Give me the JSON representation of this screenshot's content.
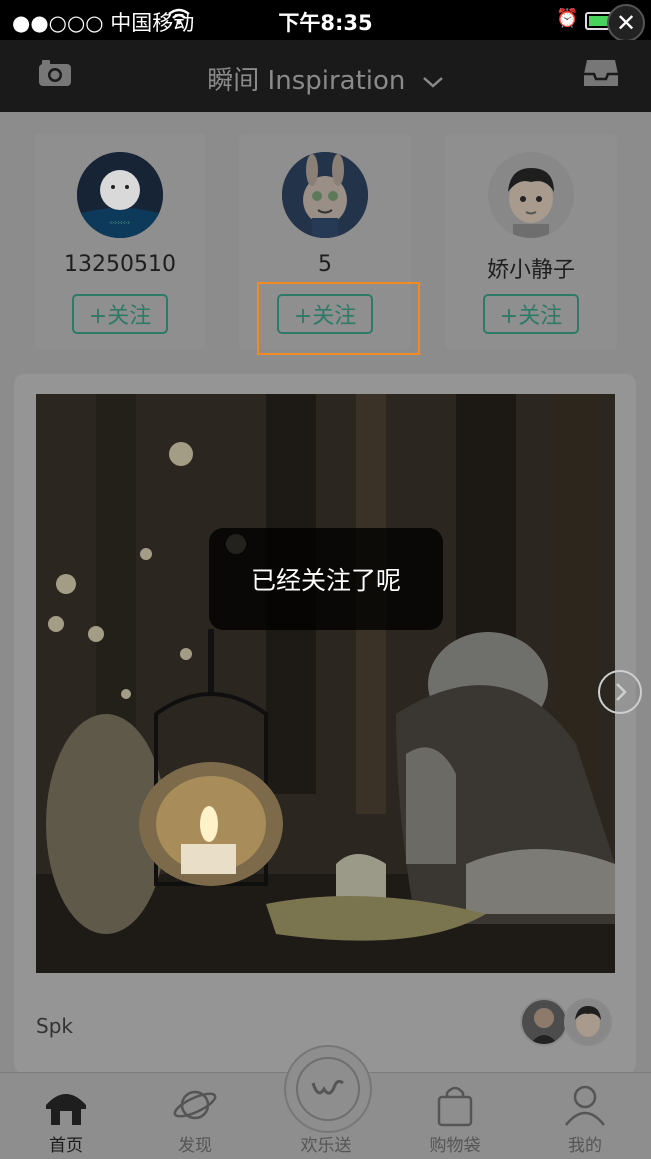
{
  "status_bar": {
    "carrier": "●●○○○ 中国移动",
    "time": "下午8:35"
  },
  "nav": {
    "title": "瞬间 Inspiration"
  },
  "users": [
    {
      "name": "13250510",
      "follow_label": "+关注"
    },
    {
      "name": "5",
      "follow_label": "+关注"
    },
    {
      "name": "娇小静子",
      "follow_label": "+关注"
    }
  ],
  "post": {
    "author": "Spk"
  },
  "toast": {
    "message": "已经关注了呢"
  },
  "tabs": [
    {
      "label": "首页"
    },
    {
      "label": "发现"
    },
    {
      "label": "欢乐送"
    },
    {
      "label": "购物袋"
    },
    {
      "label": "我的"
    }
  ],
  "colors": {
    "accent": "#2d7a66",
    "highlight": "#f08a24"
  }
}
